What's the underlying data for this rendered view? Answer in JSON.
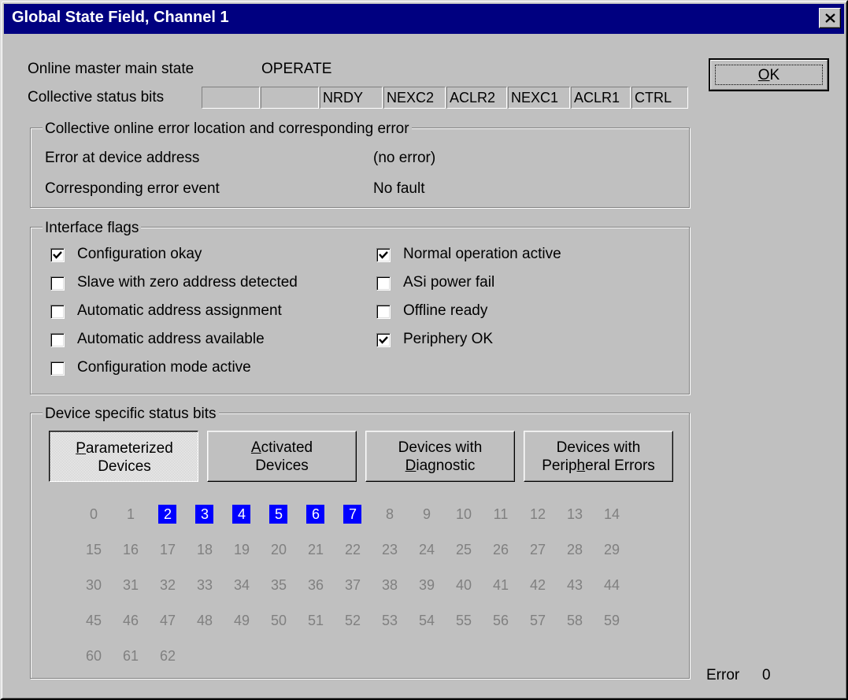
{
  "window": {
    "title": "Global State Field, Channel 1"
  },
  "master": {
    "state_label": "Online master main state",
    "state_value": "OPERATE"
  },
  "status_bits": {
    "label": "Collective status bits",
    "fields": [
      "",
      "",
      "NRDY",
      "NEXC2",
      "ACLR2",
      "NEXC1",
      "ACLR1",
      "CTRL"
    ]
  },
  "error_group": {
    "legend": "Collective online error location and corresponding error",
    "address_label": "Error at device address",
    "address_value": "(no error)",
    "event_label": "Corresponding error event",
    "event_value": "No fault"
  },
  "flags": {
    "legend": "Interface flags",
    "left": [
      {
        "label": "Configuration okay",
        "checked": true
      },
      {
        "label": "Slave with zero address detected",
        "checked": false
      },
      {
        "label": "Automatic address assignment",
        "checked": false
      },
      {
        "label": "Automatic address available",
        "checked": false
      },
      {
        "label": "Configuration mode active",
        "checked": false
      }
    ],
    "right": [
      {
        "label": "Normal operation active",
        "checked": true
      },
      {
        "label": "ASi power fail",
        "checked": false
      },
      {
        "label": "Offline ready",
        "checked": false
      },
      {
        "label": "Periphery OK",
        "checked": true
      }
    ]
  },
  "device_bits": {
    "legend": "Device specific status bits",
    "buttons": [
      {
        "pre": "",
        "u": "P",
        "post": "arameterized",
        "line2_pre": "",
        "line2_u": "",
        "line2_post": "Devices",
        "pressed": true
      },
      {
        "pre": "",
        "u": "A",
        "post": "ctivated",
        "line2_pre": "",
        "line2_u": "",
        "line2_post": "Devices",
        "pressed": false
      },
      {
        "pre": "Devices with",
        "u": "",
        "post": "",
        "line2_pre": "",
        "line2_u": "D",
        "line2_post": "iagnostic",
        "pressed": false
      },
      {
        "pre": "Devices with",
        "u": "",
        "post": "",
        "line2_pre": "Perip",
        "line2_u": "h",
        "line2_post": "eral Errors",
        "pressed": false
      }
    ],
    "addresses": [
      "0",
      "1",
      "2",
      "3",
      "4",
      "5",
      "6",
      "7",
      "8",
      "9",
      "10",
      "11",
      "12",
      "13",
      "14",
      "15",
      "16",
      "17",
      "18",
      "19",
      "20",
      "21",
      "22",
      "23",
      "24",
      "25",
      "26",
      "27",
      "28",
      "29",
      "30",
      "31",
      "32",
      "33",
      "34",
      "35",
      "36",
      "37",
      "38",
      "39",
      "40",
      "41",
      "42",
      "43",
      "44",
      "45",
      "46",
      "47",
      "48",
      "49",
      "50",
      "51",
      "52",
      "53",
      "54",
      "55",
      "56",
      "57",
      "58",
      "59",
      "60",
      "61",
      "62"
    ],
    "highlighted": [
      2,
      3,
      4,
      5,
      6,
      7
    ]
  },
  "ok_button": {
    "u": "O",
    "post": "K"
  },
  "error_status": {
    "label": "Error",
    "value": "0"
  },
  "colors": {
    "title_bar": "#000080",
    "highlight": "#0000ff",
    "face": "#c0c0c0",
    "disabled_text": "#808080"
  },
  "icons": {
    "close": "close-x-icon",
    "checkmark": "checkmark-icon"
  }
}
